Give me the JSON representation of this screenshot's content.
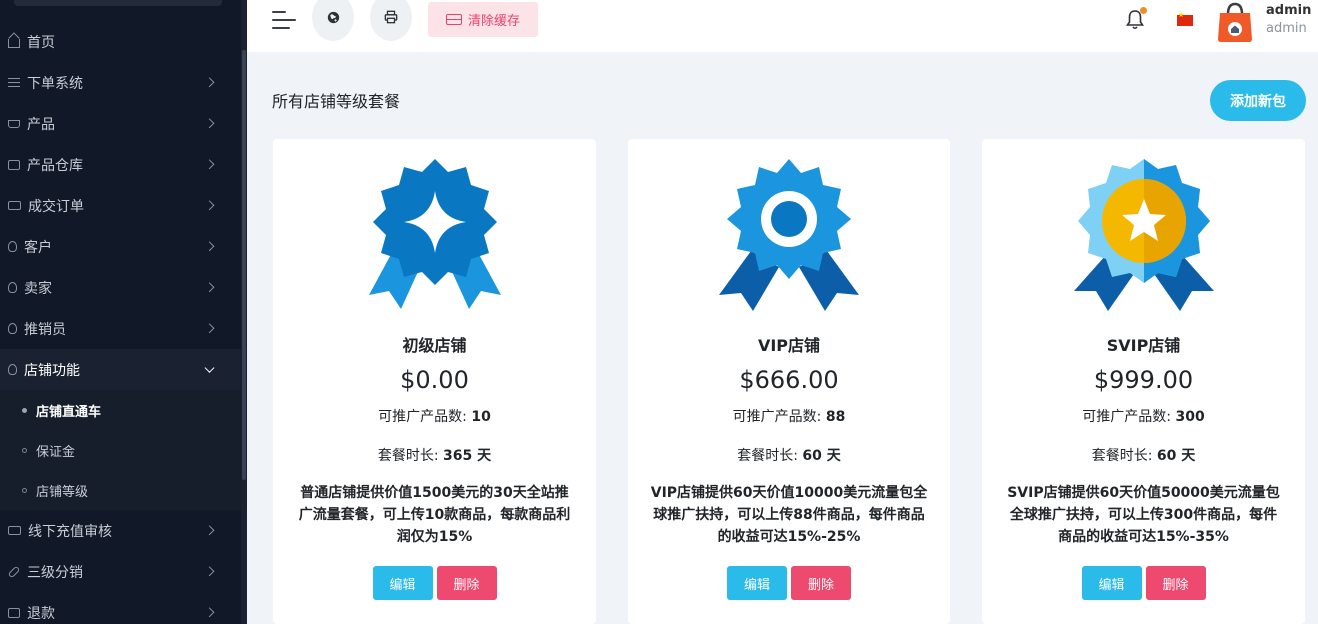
{
  "sidebar": {
    "items": [
      {
        "label": "首页",
        "icon": "home-icon"
      },
      {
        "label": "下单系统",
        "icon": "list-icon"
      },
      {
        "label": "产品",
        "icon": "cart-icon"
      },
      {
        "label": "产品仓库",
        "icon": "warehouse-icon"
      },
      {
        "label": "成交订单",
        "icon": "order-icon"
      },
      {
        "label": "客户",
        "icon": "users-icon"
      },
      {
        "label": "卖家",
        "icon": "user-icon"
      },
      {
        "label": "推销员",
        "icon": "user-icon"
      },
      {
        "label": "店铺功能",
        "icon": "user-icon"
      },
      {
        "label": "线下充值审核",
        "icon": "card-icon"
      },
      {
        "label": "三级分销",
        "icon": "link-icon"
      },
      {
        "label": "退款",
        "icon": "refund-icon"
      }
    ],
    "submenu": [
      {
        "label": "店铺直通车"
      },
      {
        "label": "保证金"
      },
      {
        "label": "店铺等级"
      }
    ]
  },
  "header": {
    "clear_cache_label": "清除缓存",
    "user_name": "admin",
    "user_role": "admin"
  },
  "main": {
    "title": "所有店铺等级套餐",
    "add_button": "添加新包"
  },
  "cards": [
    {
      "name": "初级店铺",
      "price": "$0.00",
      "products_label": "可推广产品数: ",
      "products_value": "10",
      "duration_label": "套餐时长: ",
      "duration_value": "365 天",
      "description": "普通店铺提供价值1500美元的30天全站推广流量套餐，可上传10款商品，每款商品利润仅为15%",
      "edit_label": "编辑",
      "delete_label": "删除",
      "badge_icon": "badge-star-icon"
    },
    {
      "name": "VIP店铺",
      "price": "$666.00",
      "products_label": "可推广产品数: ",
      "products_value": "88",
      "duration_label": "套餐时长: ",
      "duration_value": "60 天",
      "description": "VIP店铺提供60天价值10000美元流量包全球推广扶持，可以上传88件商品，每件商品的收益可达15%-25%",
      "edit_label": "编辑",
      "delete_label": "删除",
      "badge_icon": "badge-ring-icon"
    },
    {
      "name": "SVIP店铺",
      "price": "$999.00",
      "products_label": "可推广产品数: ",
      "products_value": "300",
      "duration_label": "套餐时长: ",
      "duration_value": "60 天",
      "description": "SVIP店铺提供60天价值50000美元流量包全球推广扶持，可以上传300件商品，每件商品的收益可达15%-35%",
      "edit_label": "编辑",
      "delete_label": "删除",
      "badge_icon": "badge-gold-star-icon"
    }
  ],
  "colors": {
    "sidebar_bg": "#111827",
    "accent": "#2bbbea",
    "danger": "#ee4a70",
    "clear_cache_bg": "#fbe3e8"
  }
}
